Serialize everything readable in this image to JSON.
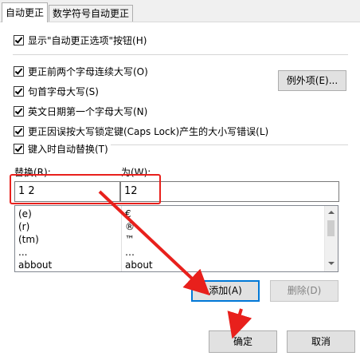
{
  "tabs": [
    {
      "label": "自动更正"
    },
    {
      "label": "数学符号自动更正"
    }
  ],
  "show_button_option": {
    "label": "显示\"自动更正选项\"按钮(H)",
    "checked": true
  },
  "options": [
    {
      "label": "更正前两个字母连续大写(O)",
      "checked": true
    },
    {
      "label": "句首字母大写(S)",
      "checked": true
    },
    {
      "label": "英文日期第一个字母大写(N)",
      "checked": true
    },
    {
      "label": "更正因误按大写锁定键(Caps Lock)产生的大小写错误(L)",
      "checked": true
    }
  ],
  "exceptions_button": "例外项(E)...",
  "replace_as_you_type": {
    "label": "键入时自动替换(T)",
    "checked": true
  },
  "replace_label": "替换(R):",
  "with_label": "为(W):",
  "replace_value": "1 2",
  "with_value": "12",
  "entries": [
    {
      "replace": "(e)",
      "with": "€"
    },
    {
      "replace": "(r)",
      "with": "®"
    },
    {
      "replace": "(tm)",
      "with": "™"
    },
    {
      "replace": "...",
      "with": "…"
    },
    {
      "replace": "abbout",
      "with": "about"
    }
  ],
  "add_button": "添加(A)",
  "delete_button": "删除(D)",
  "ok_button": "确定",
  "cancel_button": "取消",
  "colors": {
    "highlight": "#e8201c",
    "focus": "#0078d7"
  }
}
